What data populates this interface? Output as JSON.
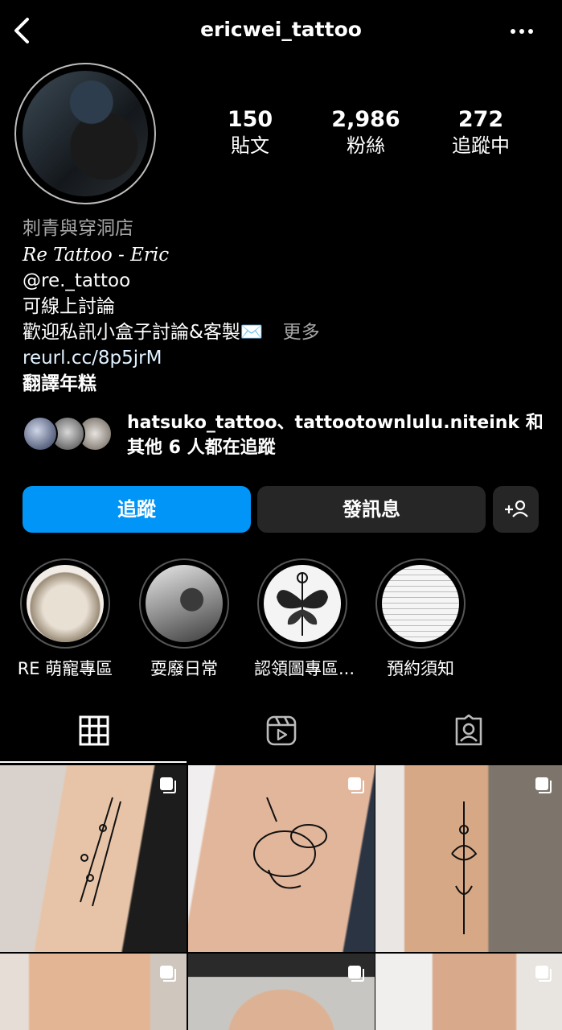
{
  "header": {
    "username": "ericwei_tattoo"
  },
  "stats": [
    {
      "value": "150",
      "label": "貼文"
    },
    {
      "value": "2,986",
      "label": "粉絲"
    },
    {
      "value": "272",
      "label": "追蹤中"
    }
  ],
  "bio": {
    "category": "刺青與穿洞店",
    "name": "Re Tattoo - Eric",
    "handle": "@re._tattoo",
    "line1": "可線上討論",
    "line2": "歡迎私訊小盒子討論&客製✉️",
    "more": "更多",
    "link": "reurl.cc/8p5jrM",
    "translate": "翻譯年糕"
  },
  "mutual": {
    "line1": "hatsuko_tattoo、tattootownlulu.niteink 和",
    "line2": "其他 6 人都在追蹤"
  },
  "actions": {
    "follow": "追蹤",
    "message": "發訊息"
  },
  "highlights": [
    {
      "label": "RE 萌寵專區"
    },
    {
      "label": "耍廢日常"
    },
    {
      "label": "認領圖專區..."
    },
    {
      "label": "預約須知"
    }
  ],
  "tabs": {
    "active": "grid"
  },
  "colors": {
    "primary": "#0095f6",
    "secondary_button": "#262626",
    "background": "#000000"
  }
}
